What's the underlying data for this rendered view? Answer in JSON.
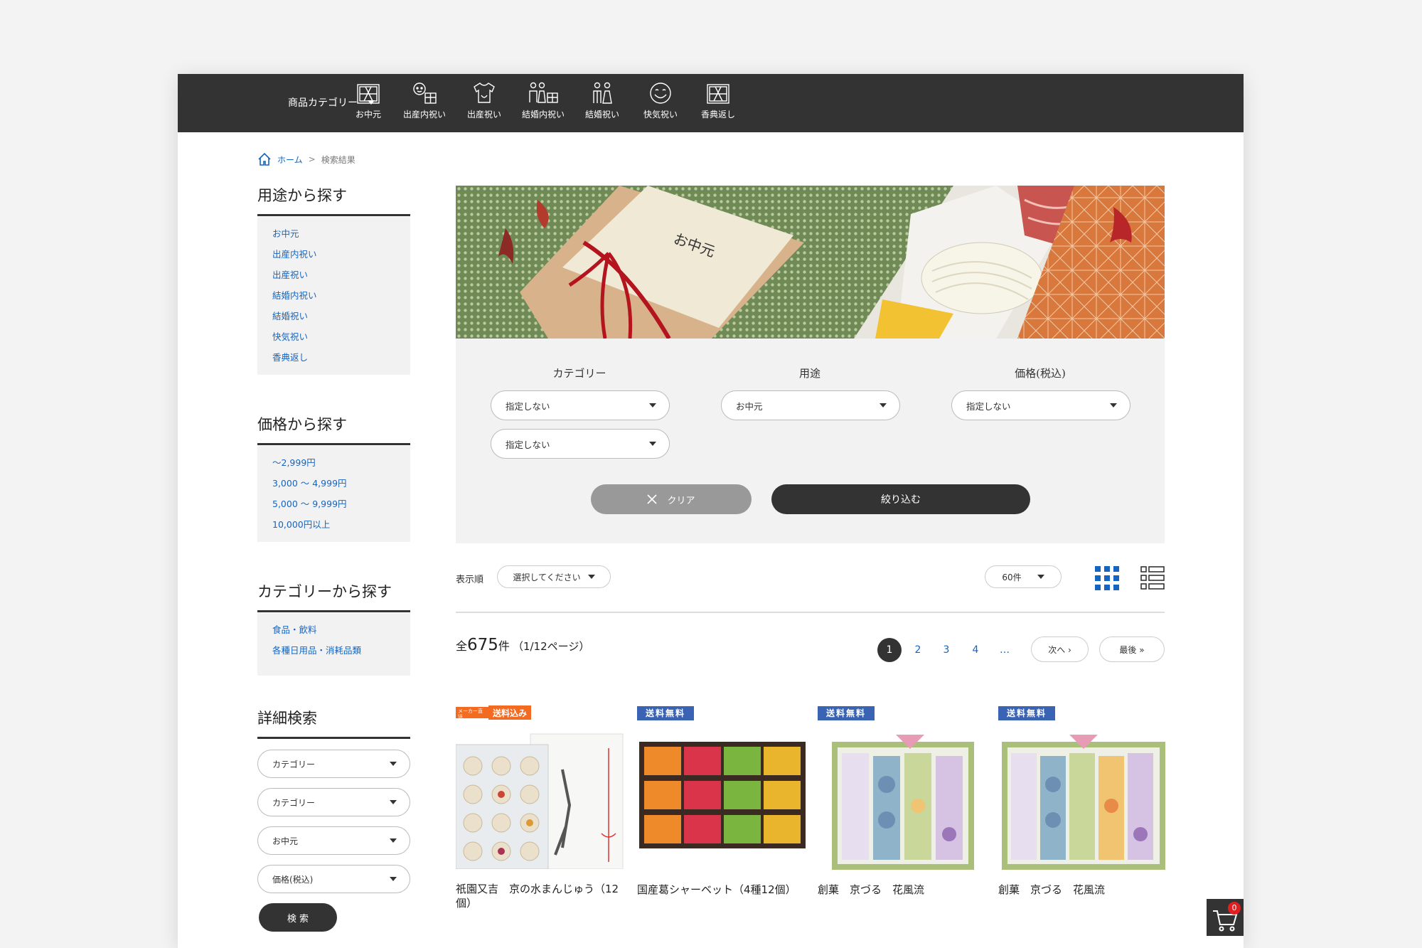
{
  "nav": {
    "category_menu": "商品カテゴリー",
    "items": [
      {
        "label": "お中元",
        "icon": "gift-box-icon"
      },
      {
        "label": "出産内祝い",
        "icon": "baby-gift-icon"
      },
      {
        "label": "出産祝い",
        "icon": "baby-clothes-icon"
      },
      {
        "label": "結婚内祝い",
        "icon": "couple-gift-icon"
      },
      {
        "label": "結婚祝い",
        "icon": "couple-icon"
      },
      {
        "label": "快気祝い",
        "icon": "smile-icon"
      },
      {
        "label": "香典返し",
        "icon": "gift-box-icon"
      }
    ]
  },
  "breadcrumb": {
    "home": "ホーム",
    "sep": ">",
    "current": "検索結果"
  },
  "sidebar": {
    "purpose": {
      "title": "用途から探す",
      "items": [
        "お中元",
        "出産内祝い",
        "出産祝い",
        "結婚内祝い",
        "結婚祝い",
        "快気祝い",
        "香典返し"
      ]
    },
    "price": {
      "title": "価格から探す",
      "items": [
        "〜2,999円",
        "3,000 〜 4,999円",
        "5,000 〜 9,999円",
        "10,000円以上"
      ]
    },
    "category": {
      "title": "カテゴリーから探す",
      "items": [
        "食品・飲料",
        "各種日用品・消耗品類"
      ]
    },
    "detail": {
      "title": "詳細検索",
      "selects": [
        "カテゴリー",
        "カテゴリー",
        "お中元",
        "価格(税込)"
      ],
      "search_button": "検 索"
    }
  },
  "banner": {
    "box_text": "お中元"
  },
  "filter": {
    "category_label": "カテゴリー",
    "category_select1": "指定しない",
    "category_select2": "指定しない",
    "purpose_label": "用途",
    "purpose_select": "お中元",
    "price_label": "価格(税込)",
    "price_select": "指定しない",
    "clear_button": "クリア",
    "submit_button": "絞り込む"
  },
  "sortbar": {
    "label": "表示順",
    "sort_select": "選択してください",
    "per_page": "60件"
  },
  "results": {
    "total_prefix": "全",
    "total": "675",
    "total_suffix": "件",
    "page_info": "（1/12ページ）"
  },
  "pagination": {
    "pages": [
      "1",
      "2",
      "3",
      "4",
      "…"
    ],
    "next": "次へ ›",
    "last": "最後 »"
  },
  "products": [
    {
      "badge": "送料込み",
      "badge_small": "メーカー直送",
      "badge_color": "#f26b21",
      "name": "祇園又吉　京の水まんじゅう（12個）"
    },
    {
      "badge": "送料無料",
      "badge_color": "#3a63b4",
      "name": "国産葛シャーベット（4種12個）"
    },
    {
      "badge": "送料無料",
      "badge_color": "#3a63b4",
      "name": "創菓　京づる　花風流"
    },
    {
      "badge": "送料無料",
      "badge_color": "#3a63b4",
      "name": "創菓　京づる　花風流"
    }
  ],
  "cart": {
    "count": "0"
  },
  "colors": {
    "topbar": "#333333",
    "link": "#1565c0",
    "panel": "#f2f2f2"
  }
}
